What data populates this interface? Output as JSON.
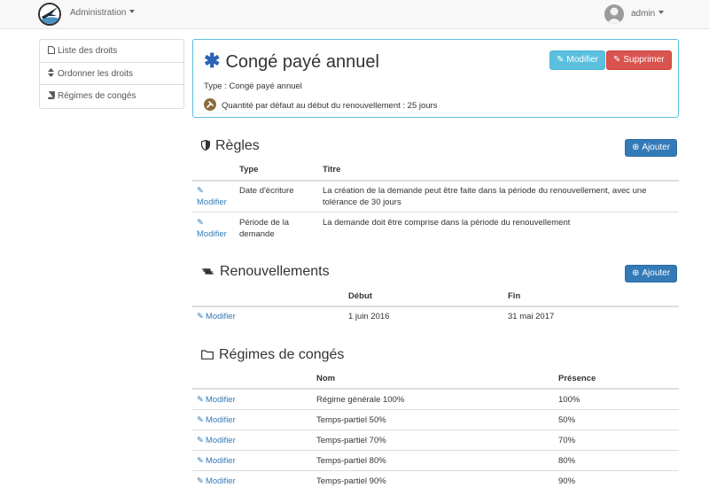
{
  "navbar": {
    "menu_label": "Administration",
    "user_name": "admin"
  },
  "sidebar": {
    "items": [
      {
        "label": "Liste des droits",
        "icon": "file-icon"
      },
      {
        "label": "Ordonner les droits",
        "icon": "sort-icon"
      },
      {
        "label": "Régimes de congés",
        "icon": "book-icon"
      }
    ]
  },
  "header": {
    "title_icon": "asterisk-icon",
    "title": "Congé payé annuel",
    "edit_label": "Modifier",
    "delete_label": "Supprimer",
    "type_line": "Type : Congé payé annuel",
    "quantity_line": "Quantité par défaut au début du renouvellement : 25 jours"
  },
  "rules": {
    "title": "Règles",
    "add_label": "Ajouter",
    "columns": [
      "Type",
      "Titre"
    ],
    "rows": [
      {
        "action": "Modifier",
        "type": "Date d'écriture",
        "title": "La création de la demande peut être faite dans la période du renouvellement, avec une tolérance de 30 jours"
      },
      {
        "action": "Modifier",
        "type": "Période de la demande",
        "title": "La demande doit être comprise dans la période du renouvellement"
      }
    ]
  },
  "renewals": {
    "title": "Renouvellements",
    "add_label": "Ajouter",
    "columns": [
      "Début",
      "Fin"
    ],
    "rows": [
      {
        "action": "Modifier",
        "start": "1 juin 2016",
        "end": "31 mai 2017"
      }
    ]
  },
  "regimes": {
    "title": "Régimes de congés",
    "columns": [
      "Nom",
      "Présence"
    ],
    "rows": [
      {
        "action": "Modifier",
        "name": "Régime générale 100%",
        "presence": "100%"
      },
      {
        "action": "Modifier",
        "name": "Temps-partiel 50%",
        "presence": "50%"
      },
      {
        "action": "Modifier",
        "name": "Temps-partiel 70%",
        "presence": "70%"
      },
      {
        "action": "Modifier",
        "name": "Temps-partiel 80%",
        "presence": "80%"
      },
      {
        "action": "Modifier",
        "name": "Temps-partiel 90%",
        "presence": "90%"
      }
    ]
  },
  "colors": {
    "accent": "#337ab7",
    "info": "#5bc0de",
    "danger": "#d9534f"
  }
}
